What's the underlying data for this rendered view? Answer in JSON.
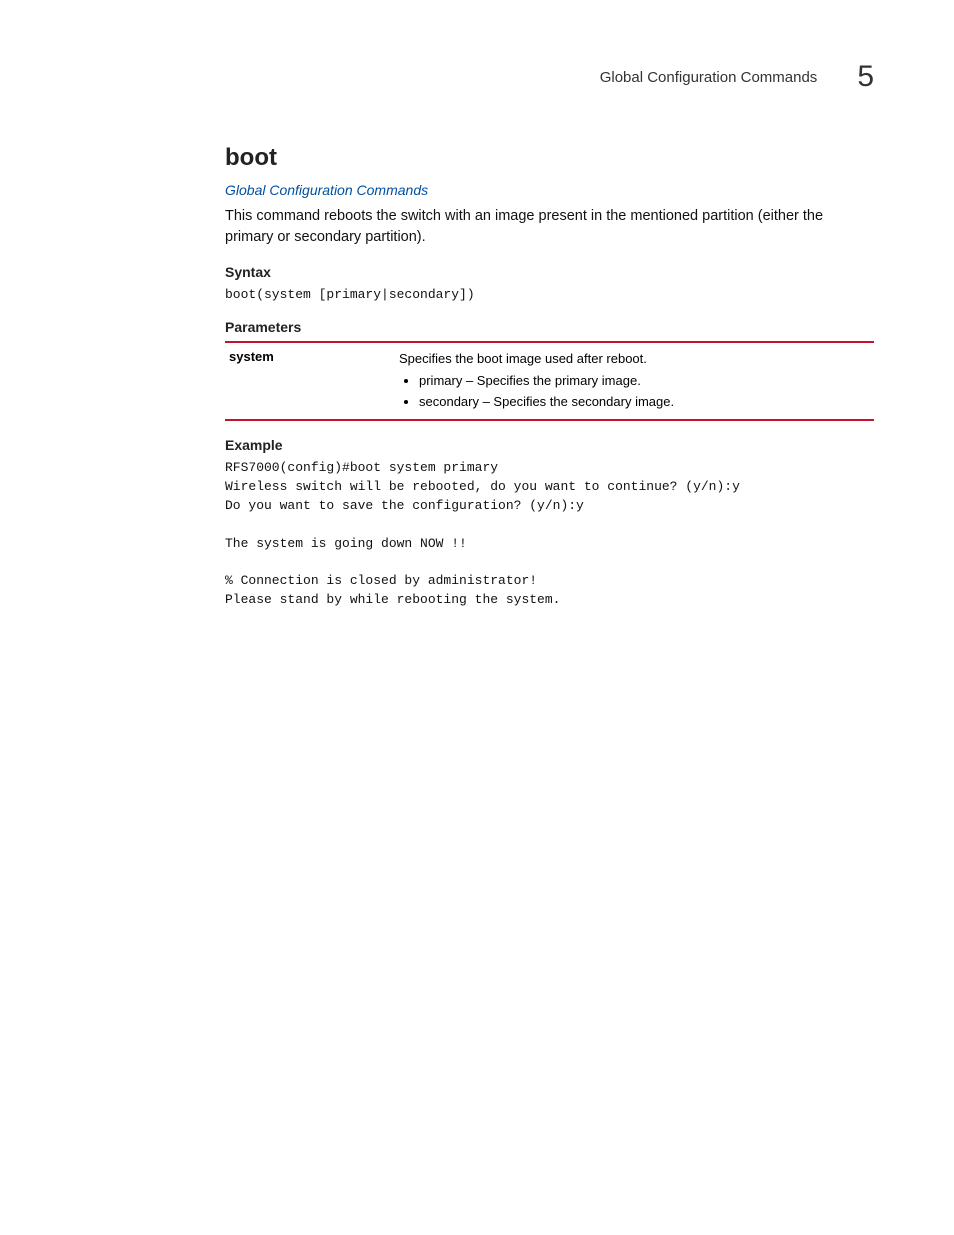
{
  "header": {
    "title": "Global Configuration Commands",
    "chapter_number": "5"
  },
  "section": {
    "title": "boot",
    "breadcrumb_link": "Global Configuration Commands",
    "description": "This command reboots the switch with an image present in the mentioned partition (either the primary or secondary partition).",
    "syntax_heading": "Syntax",
    "syntax_code": "boot(system [primary|secondary])",
    "parameters_heading": "Parameters",
    "parameters": {
      "name": "system",
      "description": "Specifies the boot image used after reboot.",
      "bullets": [
        "primary – Specifies the primary image.",
        "secondary – Specifies the secondary image."
      ]
    },
    "example_heading": "Example",
    "example_code": "RFS7000(config)#boot system primary\nWireless switch will be rebooted, do you want to continue? (y/n):y\nDo you want to save the configuration? (y/n):y\n\nThe system is going down NOW !!\n\n% Connection is closed by administrator!\nPlease stand by while rebooting the system."
  }
}
